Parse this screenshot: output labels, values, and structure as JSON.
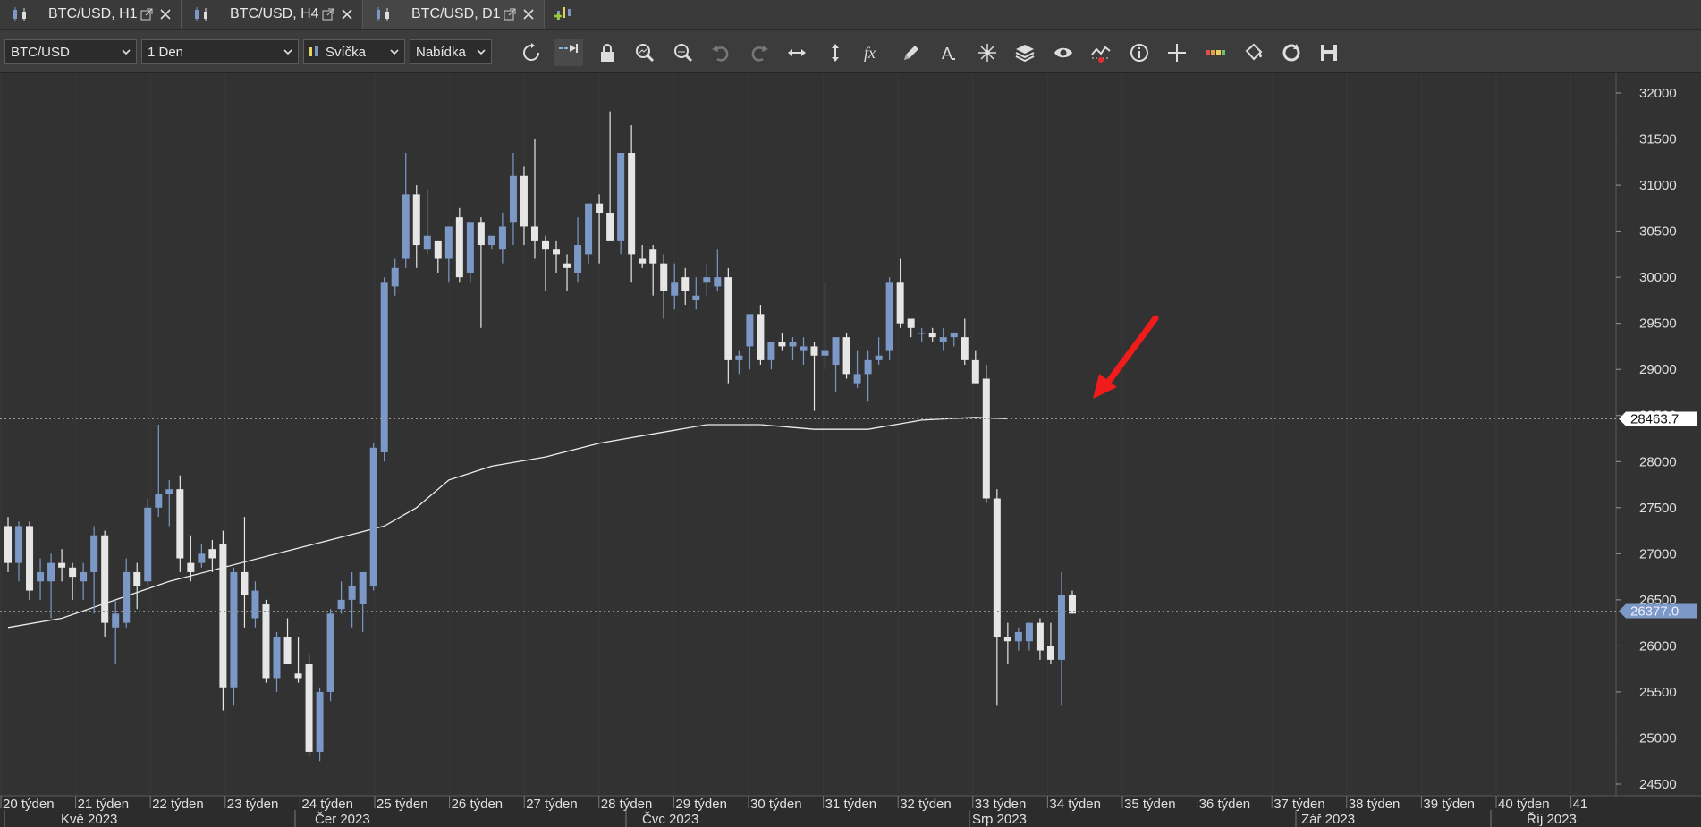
{
  "tabs": [
    {
      "label": "BTC/USD, H1",
      "active": false
    },
    {
      "label": "BTC/USD, H4",
      "active": false
    },
    {
      "label": "BTC/USD, D1",
      "active": true
    }
  ],
  "toolbar": {
    "symbol": "BTC/USD",
    "timeframe": "1 Den",
    "chart_type": "Svíčka",
    "price_type": "Nabídka",
    "icons": [
      "refresh-icon",
      "auto-scroll-icon",
      "lock-icon",
      "zoom-in-icon",
      "zoom-out-icon",
      "undo-icon",
      "redo-icon",
      "horizontal-resize-icon",
      "vertical-resize-icon",
      "indicators-fx-icon",
      "pencil-icon",
      "text-icon",
      "objects-icon",
      "layers-icon",
      "eye-icon",
      "chart-alert-icon",
      "info-icon",
      "crosshair-icon",
      "color-palette-icon",
      "fill-icon",
      "reset-icon",
      "save-icon"
    ]
  },
  "colors": {
    "bull": "#7b98c6",
    "bear": "#e6e6e6",
    "ma": "#ececec",
    "arrow": "#f01c1c",
    "current_tag": "#7b98c6",
    "ma_tag": "#ffffff"
  },
  "price_labels": {
    "ma_value": "28463.7",
    "current_value": "26377.0"
  },
  "chart_data": {
    "type": "candlestick",
    "y_ticks": [
      32000,
      31500,
      31000,
      30500,
      30000,
      29500,
      29000,
      28500,
      28000,
      27500,
      27000,
      26500,
      26000,
      25500,
      25000,
      24500
    ],
    "ylim": [
      24400,
      32100
    ],
    "week_labels": [
      "20 týden",
      "21 týden",
      "22 týden",
      "23 týden",
      "24 týden",
      "25 týden",
      "26 týden",
      "27 týden",
      "28 týden",
      "29 týden",
      "30 týden",
      "31 týden",
      "32 týden",
      "33 týden",
      "34 týden",
      "35 týden",
      "36 týden",
      "37 týden",
      "38 týden",
      "39 týden",
      "40 týden",
      "41"
    ],
    "month_labels": [
      "Kvě 2023",
      "Čer 2023",
      "Čvc 2023",
      "Srp 2023",
      "Zář 2023",
      "Říj 2023"
    ],
    "candles": [
      [
        27300,
        27400,
        26800,
        26900
      ],
      [
        26900,
        27350,
        26700,
        27300
      ],
      [
        27300,
        27350,
        26500,
        26600
      ],
      [
        26700,
        26950,
        26500,
        26800
      ],
      [
        26700,
        27000,
        26300,
        26900
      ],
      [
        26900,
        27050,
        26700,
        26850
      ],
      [
        26850,
        26900,
        26500,
        26750
      ],
      [
        26700,
        26900,
        26500,
        26800
      ],
      [
        26800,
        27300,
        26350,
        27200
      ],
      [
        27200,
        27250,
        26100,
        26250
      ],
      [
        26200,
        26500,
        25800,
        26350
      ],
      [
        26250,
        26950,
        26200,
        26800
      ],
      [
        26800,
        26900,
        26400,
        26650
      ],
      [
        26700,
        27600,
        26650,
        27500
      ],
      [
        27500,
        28400,
        27400,
        27650
      ],
      [
        27650,
        27800,
        27300,
        27700
      ],
      [
        27700,
        27850,
        26800,
        26950
      ],
      [
        26900,
        27200,
        26700,
        26800
      ],
      [
        26900,
        27100,
        26850,
        27000
      ],
      [
        27050,
        27150,
        26800,
        26950
      ],
      [
        27100,
        27250,
        25300,
        25550
      ],
      [
        25550,
        26850,
        25350,
        26800
      ],
      [
        26800,
        27400,
        26200,
        26550
      ],
      [
        26300,
        26700,
        26200,
        26600
      ],
      [
        26450,
        26500,
        25600,
        25650
      ],
      [
        25650,
        26150,
        25500,
        26100
      ],
      [
        26100,
        26300,
        25800,
        25800
      ],
      [
        25700,
        26100,
        25600,
        25650
      ],
      [
        25800,
        25900,
        24800,
        24850
      ],
      [
        24850,
        25550,
        24750,
        25500
      ],
      [
        25500,
        26400,
        25400,
        26350
      ],
      [
        26400,
        26700,
        26350,
        26500
      ],
      [
        26500,
        26800,
        26200,
        26650
      ],
      [
        26450,
        26600,
        26150,
        26800
      ],
      [
        26650,
        28200,
        26600,
        28150
      ],
      [
        28100,
        30000,
        28000,
        29950
      ],
      [
        29900,
        30200,
        29800,
        30100
      ],
      [
        30200,
        31350,
        30100,
        30900
      ],
      [
        30900,
        31000,
        30100,
        30350
      ],
      [
        30300,
        30950,
        30250,
        30450
      ],
      [
        30400,
        30400,
        30050,
        30200
      ],
      [
        30200,
        30400,
        29950,
        30550
      ],
      [
        30650,
        30750,
        29950,
        30000
      ],
      [
        30050,
        30150,
        29950,
        30600
      ],
      [
        30600,
        30650,
        29450,
        30350
      ],
      [
        30350,
        30400,
        30300,
        30450
      ],
      [
        30300,
        30700,
        30150,
        30550
      ],
      [
        30600,
        31350,
        30350,
        31100
      ],
      [
        31100,
        31200,
        30350,
        30550
      ],
      [
        30550,
        31500,
        30200,
        30400
      ],
      [
        30400,
        30450,
        29850,
        30300
      ],
      [
        30300,
        30400,
        30050,
        30250
      ],
      [
        30150,
        30250,
        29850,
        30100
      ],
      [
        30050,
        30650,
        29950,
        30350
      ],
      [
        30250,
        30750,
        30150,
        30800
      ],
      [
        30800,
        30900,
        30150,
        30700
      ],
      [
        30700,
        31800,
        30450,
        30400
      ],
      [
        30400,
        31350,
        30250,
        31350
      ],
      [
        31350,
        31650,
        29950,
        30250
      ],
      [
        30200,
        30350,
        30100,
        30150
      ],
      [
        30300,
        30350,
        29800,
        30150
      ],
      [
        30150,
        30250,
        29550,
        29850
      ],
      [
        29800,
        30150,
        29650,
        29950
      ],
      [
        30000,
        30100,
        29700,
        29850
      ],
      [
        29750,
        30000,
        29650,
        29800
      ],
      [
        29950,
        30150,
        29800,
        30000
      ],
      [
        29900,
        30300,
        29850,
        30000
      ],
      [
        30000,
        30100,
        28850,
        29100
      ],
      [
        29100,
        29200,
        28950,
        29150
      ],
      [
        29250,
        29550,
        29000,
        29600
      ],
      [
        29600,
        29700,
        29050,
        29100
      ],
      [
        29100,
        29300,
        29000,
        29300
      ],
      [
        29300,
        29400,
        29200,
        29250
      ],
      [
        29250,
        29350,
        29100,
        29300
      ],
      [
        29200,
        29350,
        29050,
        29250
      ],
      [
        29250,
        29300,
        28550,
        29150
      ],
      [
        29150,
        29950,
        29000,
        29200
      ],
      [
        29050,
        29300,
        28750,
        29350
      ],
      [
        29350,
        29400,
        28900,
        28950
      ],
      [
        28850,
        29200,
        28800,
        28950
      ],
      [
        28950,
        29200,
        28650,
        29100
      ],
      [
        29100,
        29350,
        29050,
        29150
      ],
      [
        29200,
        30000,
        29100,
        29950
      ],
      [
        29950,
        30200,
        29450,
        29500
      ],
      [
        29550,
        29550,
        29350,
        29450
      ],
      [
        29400,
        29450,
        29300,
        29400
      ],
      [
        29400,
        29450,
        29300,
        29350
      ],
      [
        29300,
        29450,
        29200,
        29350
      ],
      [
        29350,
        29400,
        29250,
        29400
      ],
      [
        29350,
        29550,
        29050,
        29100
      ],
      [
        29100,
        29200,
        28850,
        28850
      ],
      [
        28900,
        29050,
        27550,
        27600
      ],
      [
        27600,
        27700,
        25350,
        26100
      ],
      [
        26100,
        26250,
        25800,
        26050
      ],
      [
        26050,
        26200,
        25950,
        26150
      ],
      [
        26050,
        26250,
        25950,
        26250
      ],
      [
        26250,
        26300,
        25850,
        25950
      ],
      [
        26000,
        26250,
        25800,
        25850
      ],
      [
        25850,
        26800,
        25350,
        26550
      ],
      [
        26550,
        26600,
        26350,
        26350
      ]
    ],
    "moving_average": [
      [
        0,
        26200
      ],
      [
        5,
        26300
      ],
      [
        10,
        26500
      ],
      [
        15,
        26700
      ],
      [
        20,
        26850
      ],
      [
        25,
        27000
      ],
      [
        30,
        27150
      ],
      [
        35,
        27300
      ],
      [
        38,
        27500
      ],
      [
        41,
        27800
      ],
      [
        45,
        27950
      ],
      [
        50,
        28050
      ],
      [
        55,
        28200
      ],
      [
        60,
        28300
      ],
      [
        65,
        28400
      ],
      [
        70,
        28400
      ],
      [
        75,
        28350
      ],
      [
        80,
        28350
      ],
      [
        85,
        28450
      ],
      [
        90,
        28480
      ],
      [
        93,
        28463.7
      ]
    ]
  }
}
